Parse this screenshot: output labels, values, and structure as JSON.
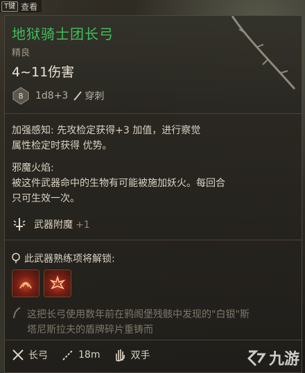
{
  "topbar": {
    "key": "T键",
    "label": "查看"
  },
  "item": {
    "name": "地狱骑士团长弓",
    "rarity": "精良",
    "damage": "4~11伤害",
    "die_label": "8",
    "dice": "1d8+3",
    "damage_type": "穿刺"
  },
  "passives": [
    {
      "title": "加强感知:",
      "body_line1": "先攻检定获得+3 加值，进行察觉",
      "body_line2": "属性检定时获得 优势。"
    },
    {
      "title": "邪魔火焰:",
      "body_line1": "被这件武器命中的生物有可能被施加妖火。每回合",
      "body_line2": "只可生效一次。"
    }
  ],
  "enchant": {
    "label": "武器附魔",
    "bonus": "+1"
  },
  "proficiency": {
    "label": "此武器熟练项将解锁:"
  },
  "flavor": {
    "line1": "这把长弓使用数年前在鸦阁堡残骸中发现的\"白银\"斯",
    "line2": "塔尼斯拉夫的盾牌碎片重铸而"
  },
  "footer": {
    "type": "长弓",
    "range": "18m",
    "hands": "双手"
  },
  "watermark": {
    "text": "九游"
  },
  "colors": {
    "name": "#3fbf5a",
    "text": "#d9d2c3",
    "muted": "#7e776a"
  }
}
